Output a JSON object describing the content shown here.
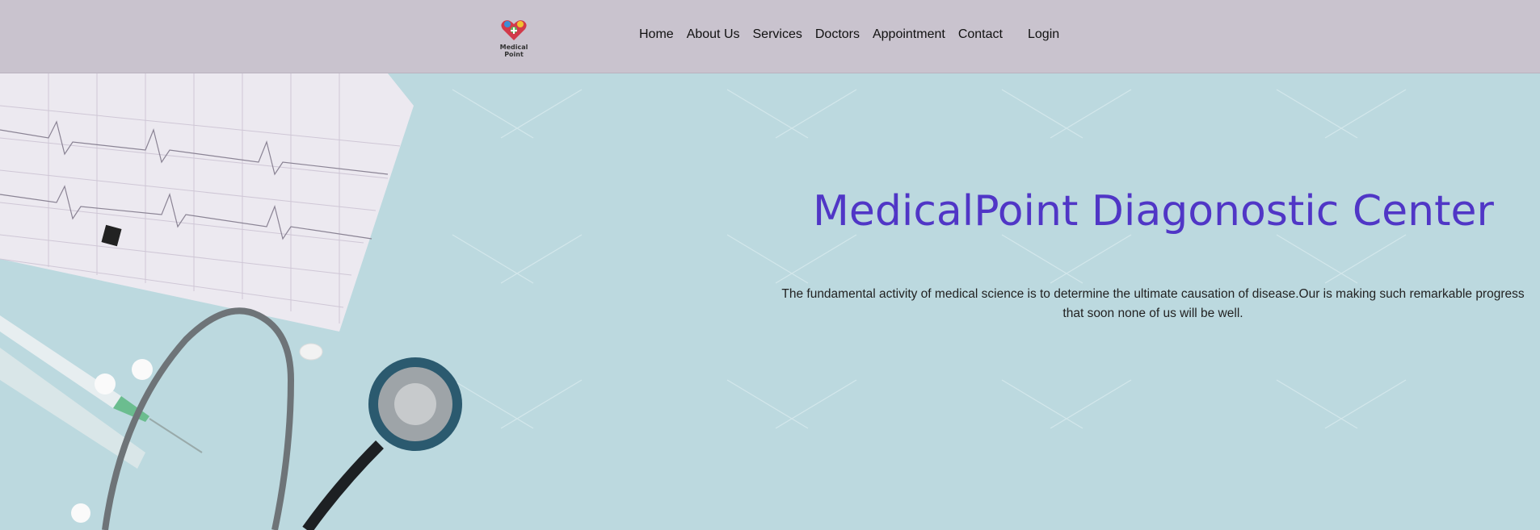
{
  "navbar": {
    "logo_text": "Medical Point",
    "links": [
      "Home",
      "About Us",
      "Services",
      "Doctors",
      "Appointment",
      "Contact"
    ],
    "login_label": "Login"
  },
  "hero": {
    "title": "MedicalPoint Diagonostic Center",
    "description": "The fundamental activity of medical science is to determine the ultimate causation of disease.Our is making such remarkable progress that soon none of us will be well."
  },
  "colors": {
    "navbar_bg": "#c9c3ce",
    "hero_bg": "#bcd9df",
    "title_color": "#5036c6"
  }
}
